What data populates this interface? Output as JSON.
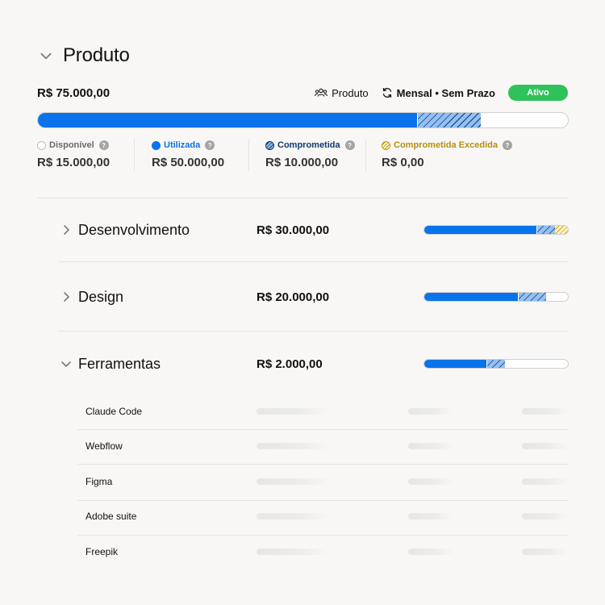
{
  "header": {
    "title": "Produto"
  },
  "summary": {
    "total": "R$ 75.000,00",
    "category_label": "Produto",
    "period_label": "Mensal • Sem Prazo",
    "status": "Ativo",
    "status_color": "#2fc25b"
  },
  "main_bar": {
    "used_pct": 71.5,
    "committed_pct": 12
  },
  "legend": [
    {
      "key": "avail",
      "label": "Disponível",
      "value": "R$ 15.000,00"
    },
    {
      "key": "used",
      "label": "Utilizada",
      "value": "R$ 50.000,00"
    },
    {
      "key": "comm",
      "label": "Comprometida",
      "value": "R$ 10.000,00"
    },
    {
      "key": "exc",
      "label": "Comprometida Excedida",
      "value": "R$ 0,00"
    }
  ],
  "categories": [
    {
      "name": "Desenvolvimento",
      "amount": "R$ 30.000,00",
      "expanded": false,
      "used_pct": 78,
      "committed_pct": 13,
      "exceeded_pct": 9
    },
    {
      "name": "Design",
      "amount": "R$ 20.000,00",
      "expanded": false,
      "used_pct": 65,
      "committed_pct": 20,
      "exceeded_pct": 0
    },
    {
      "name": "Ferramentas",
      "amount": "R$ 2.000,00",
      "expanded": true,
      "used_pct": 43,
      "committed_pct": 13,
      "exceeded_pct": 0,
      "items": [
        "Claude Code",
        "Webflow",
        "Figma",
        "Adobe suite",
        "Freepik"
      ]
    }
  ],
  "colors": {
    "used": "#0a73ec",
    "committed": "#93bff5",
    "committed_stripe": "#0d3a70",
    "exceeded": "#fbf2c6",
    "exceeded_stripe": "#d6a81b",
    "available": "#ffffff"
  },
  "icons": {
    "collapse": "chevron-down-icon",
    "expand": "chevron-right-icon",
    "category": "users-icon",
    "period": "refresh-icon",
    "help": "help-icon"
  }
}
